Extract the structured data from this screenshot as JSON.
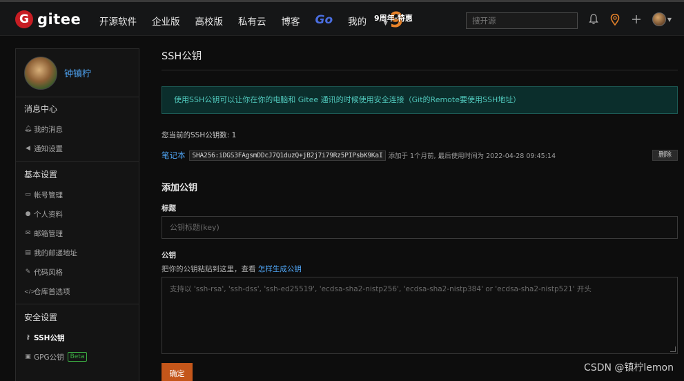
{
  "header": {
    "logo_mark": "G",
    "logo_text": "gitee",
    "nav": [
      "开源软件",
      "企业版",
      "高校版",
      "私有云",
      "博客"
    ],
    "go_label": "Go",
    "my_label": "我的",
    "promo_label": "9周年·特惠",
    "promo_digit": "9",
    "search_placeholder": "搜开源"
  },
  "sidebar": {
    "user_name": "钟镇柠",
    "sections": [
      {
        "title": "消息中心",
        "items": [
          "我的消息",
          "通知设置"
        ]
      },
      {
        "title": "基本设置",
        "items": [
          "帐号管理",
          "个人资料",
          "邮箱管理",
          "我的邮递地址",
          "代码风格",
          "仓库首选项"
        ]
      },
      {
        "title": "安全设置",
        "items": [
          "SSH公钥",
          "GPG公钥"
        ]
      }
    ],
    "beta_label": "Beta"
  },
  "main": {
    "page_title": "SSH公钥",
    "info": "使用SSH公钥可以让你在你的电脑和 Gitee 通讯的时候使用安全连接（Git的Remote要使用SSH地址）",
    "count_text": "您当前的SSH公钥数: 1",
    "key": {
      "name": "笔记本",
      "fingerprint": "SHA256:iDGS3FAgsmDDcJ7Q1duzQ+jB2j7i79Rz5PIPsbK9KaI",
      "meta": "添加于 1个月前, 最后使用时间为 2022-04-28 09:45:14",
      "delete_label": "删除"
    },
    "add_title": "添加公钥",
    "title_label": "标题",
    "title_placeholder": "公钥标题(key)",
    "key_label": "公钥",
    "help_text": "把你的公钥粘贴到这里，查看 ",
    "help_link": "怎样生成公钥",
    "key_placeholder": "支持以 'ssh-rsa', 'ssh-dss', 'ssh-ed25519', 'ecdsa-sha2-nistp256', 'ecdsa-sha2-nistp384' or 'ecdsa-sha2-nistp521' 开头",
    "submit_label": "确定"
  },
  "watermark": "CSDN @镇柠lemon",
  "colors": {
    "brand": "#c71d23",
    "link": "#4ea3f2",
    "submit": "#c4561a",
    "info_text": "#50c8bc",
    "beta": "#3cb043"
  }
}
